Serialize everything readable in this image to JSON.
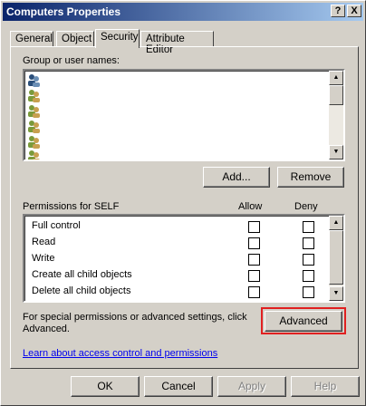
{
  "window": {
    "title": "Computers Properties",
    "help_btn": "?",
    "close_btn": "X"
  },
  "tabs": [
    {
      "label": "General"
    },
    {
      "label": "Object"
    },
    {
      "label": "Security"
    },
    {
      "label": "Attribute Editor"
    }
  ],
  "security": {
    "group_label": "Group or user names:",
    "add_label": "Add...",
    "remove_label": "Remove",
    "permissions_label": "Permissions for SELF",
    "allow_header": "Allow",
    "deny_header": "Deny",
    "permissions": [
      {
        "name": "Full control",
        "allow": false,
        "deny": false
      },
      {
        "name": "Read",
        "allow": false,
        "deny": false
      },
      {
        "name": "Write",
        "allow": false,
        "deny": false
      },
      {
        "name": "Create all child objects",
        "allow": false,
        "deny": false
      },
      {
        "name": "Delete all child objects",
        "allow": false,
        "deny": false
      }
    ],
    "special_text_1": "For special permissions or advanced settings, click",
    "special_text_2": "Advanced.",
    "advanced_label": "Advanced",
    "link_text": "Learn about access control and permissions"
  },
  "footer": {
    "ok_label": "OK",
    "cancel_label": "Cancel",
    "apply_label": "Apply",
    "help_label": "Help"
  },
  "colors": {
    "title_start": "#0a246a",
    "title_end": "#a6caf0",
    "highlight": "#e02020",
    "face": "#d4d0c8"
  }
}
